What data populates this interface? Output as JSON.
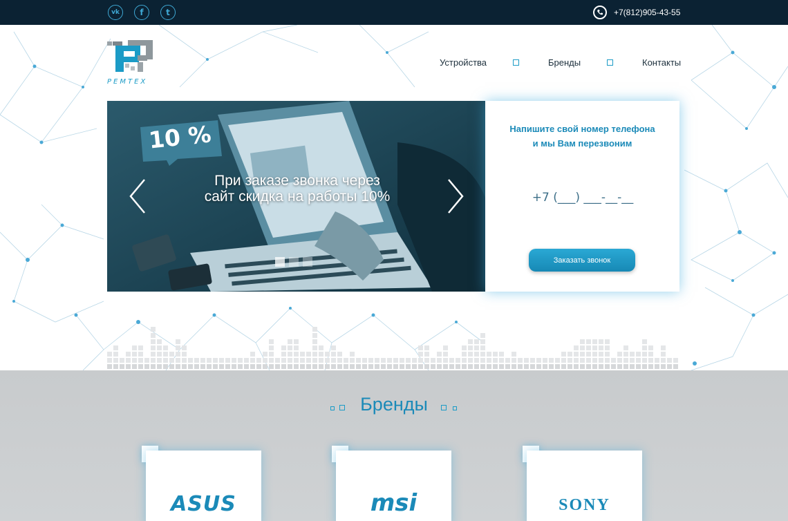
{
  "topbar": {
    "social": [
      {
        "name": "vk",
        "glyph": "vk"
      },
      {
        "name": "facebook",
        "glyph": "f"
      },
      {
        "name": "twitter",
        "glyph": "t"
      }
    ],
    "phone": "+7(812)905-43-55"
  },
  "logo": {
    "text": "РЕМТЕХ"
  },
  "nav": {
    "items": [
      "Устройства",
      "Бренды",
      "Контакты"
    ]
  },
  "slider": {
    "badge": "10 %",
    "caption": "При заказе звонка через сайт скидка на работы 10%",
    "slides_count": 3,
    "active_slide": 1
  },
  "callback": {
    "title_line1": "Напишите свой номер телефона",
    "title_line2": "и мы Вам перезвоним",
    "phone_mask": "+7 (___) ___-__-__",
    "button": "Заказать звонок"
  },
  "brands": {
    "title": "Бренды",
    "items": [
      "ASUS",
      "msi",
      "SONY"
    ]
  },
  "colors": {
    "accent": "#1b9bc6",
    "topbar": "#0b2233",
    "button": "#1789b5"
  }
}
